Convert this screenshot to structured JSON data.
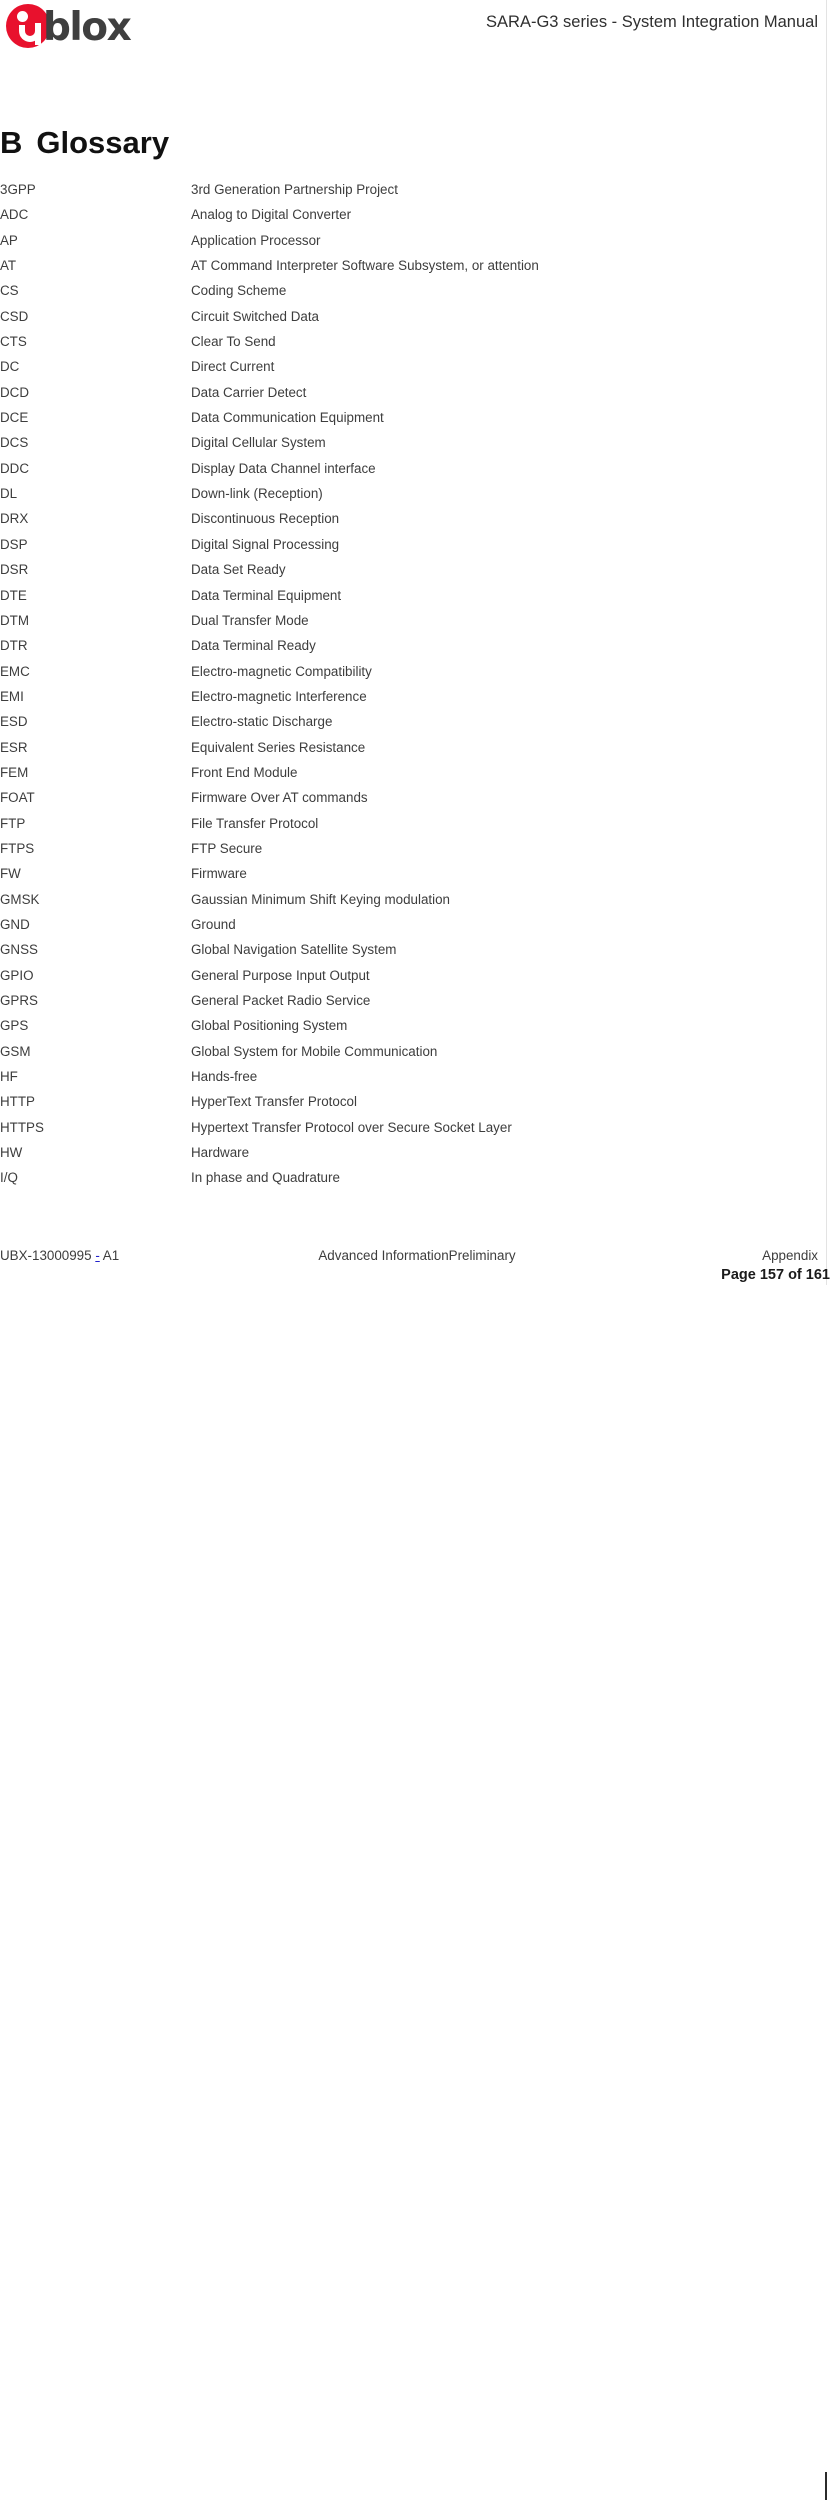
{
  "header": {
    "logo_text": "blox",
    "logo_icon": "ublox-logo",
    "title": "SARA-G3 series - System Integration Manual"
  },
  "section": {
    "number": "B",
    "title": "Glossary"
  },
  "glossary": {
    "entries": [
      {
        "term": "3GPP",
        "definition": "3rd Generation Partnership Project"
      },
      {
        "term": "ADC",
        "definition": "Analog to Digital Converter"
      },
      {
        "term": "AP",
        "definition": "Application Processor"
      },
      {
        "term": "AT",
        "definition": "AT Command Interpreter Software Subsystem, or attention"
      },
      {
        "term": "CS",
        "definition": "Coding Scheme"
      },
      {
        "term": "CSD",
        "definition": "Circuit Switched Data"
      },
      {
        "term": "CTS",
        "definition": "Clear To Send"
      },
      {
        "term": "DC",
        "definition": "Direct Current"
      },
      {
        "term": "DCD",
        "definition": "Data Carrier Detect"
      },
      {
        "term": "DCE",
        "definition": "Data Communication Equipment"
      },
      {
        "term": "DCS",
        "definition": "Digital Cellular System"
      },
      {
        "term": "DDC",
        "definition": "Display Data Channel interface"
      },
      {
        "term": "DL",
        "definition": "Down-link (Reception)"
      },
      {
        "term": "DRX",
        "definition": "Discontinuous Reception"
      },
      {
        "term": "DSP",
        "definition": "Digital Signal Processing"
      },
      {
        "term": "DSR",
        "definition": "Data Set Ready"
      },
      {
        "term": "DTE",
        "definition": "Data Terminal Equipment"
      },
      {
        "term": "DTM",
        "definition": "Dual Transfer Mode"
      },
      {
        "term": "DTR",
        "definition": "Data Terminal Ready"
      },
      {
        "term": "EMC",
        "definition": "Electro-magnetic Compatibility"
      },
      {
        "term": "EMI",
        "definition": "Electro-magnetic Interference"
      },
      {
        "term": "ESD",
        "definition": "Electro-static Discharge"
      },
      {
        "term": "ESR",
        "definition": "Equivalent Series Resistance"
      },
      {
        "term": "FEM",
        "definition": "Front End Module"
      },
      {
        "term": "FOAT",
        "definition": "Firmware Over AT commands"
      },
      {
        "term": "FTP",
        "definition": "File Transfer Protocol"
      },
      {
        "term": "FTPS",
        "definition": "FTP Secure"
      },
      {
        "term": "FW",
        "definition": "Firmware"
      },
      {
        "term": "GMSK",
        "definition": "Gaussian Minimum Shift Keying modulation"
      },
      {
        "term": "GND",
        "definition": "Ground"
      },
      {
        "term": "GNSS",
        "definition": "Global Navigation Satellite System"
      },
      {
        "term": "GPIO",
        "definition": "General Purpose Input Output"
      },
      {
        "term": "GPRS",
        "definition": "General Packet Radio Service"
      },
      {
        "term": "GPS",
        "definition": "Global Positioning System"
      },
      {
        "term": "GSM",
        "definition": "Global System for Mobile Communication"
      },
      {
        "term": "HF",
        "definition": "Hands-free"
      },
      {
        "term": "HTTP",
        "definition": "HyperText Transfer Protocol"
      },
      {
        "term": "HTTPS",
        "definition": "Hypertext Transfer Protocol over Secure Socket Layer"
      },
      {
        "term": "HW",
        "definition": "Hardware"
      },
      {
        "term": "I/Q",
        "definition": "In phase and Quadrature"
      }
    ]
  },
  "footer": {
    "doc_id_prefix": "UBX-13000995",
    "doc_id_dash": "-",
    "doc_id_suffix": "A1",
    "status": "Advanced InformationPreliminary",
    "section_label": "Appendix",
    "page_label": "Page 157 of 161"
  },
  "colors": {
    "brand_red": "#e8112d",
    "logo_text": "#3f3f3f",
    "body_text": "#3d3d3d",
    "link_blue": "#2222cc"
  }
}
